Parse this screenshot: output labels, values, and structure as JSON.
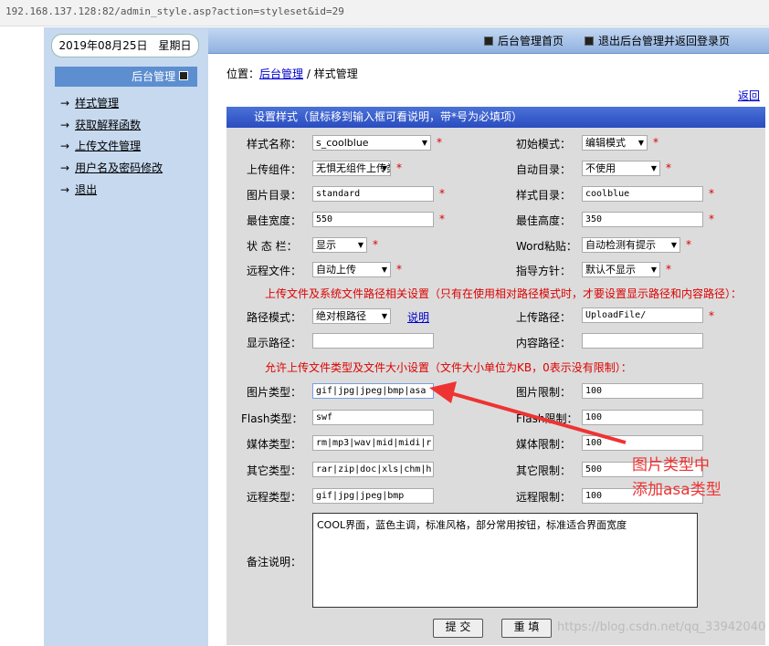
{
  "url": "192.168.137.128:82/admin_style.asp?action=styleset&id=29",
  "date": "2019年08月25日　星期日",
  "top_links": [
    "后台管理首页",
    "退出后台管理并返回登录页"
  ],
  "sidebar": {
    "header": "后台管理",
    "items": [
      "样式管理",
      "获取解释函数",
      "上传文件管理",
      "用户名及密码修改",
      "退出"
    ]
  },
  "breadcrumb": {
    "prefix": "位置：",
    "link": "后台管理",
    "sep": " / ",
    "current": "样式管理"
  },
  "back": "返回",
  "form": {
    "title": "设置样式（鼠标移到输入框可看说明，带*号为必填项）",
    "star": "*",
    "rows_left": [
      {
        "label": "样式名称：",
        "value": "s_coolblue",
        "type": "input"
      },
      {
        "label": "上传组件：",
        "value": "无惧无组件上传类",
        "type": "select"
      },
      {
        "label": "图片目录：",
        "value": "standard",
        "type": "input"
      },
      {
        "label": "最佳宽度：",
        "value": "550",
        "type": "input"
      },
      {
        "label": "状 态 栏：",
        "value": "显示",
        "type": "select"
      },
      {
        "label": "远程文件：",
        "value": "自动上传",
        "type": "select"
      }
    ],
    "rows_right": [
      {
        "label": "初始模式：",
        "value": "编辑模式",
        "type": "select"
      },
      {
        "label": "自动目录：",
        "value": "不使用",
        "type": "select"
      },
      {
        "label": "样式目录：",
        "value": "coolblue",
        "type": "input"
      },
      {
        "label": "最佳高度：",
        "value": "350",
        "type": "input"
      },
      {
        "label": "Word粘贴：",
        "value": "自动检测有提示",
        "type": "select"
      },
      {
        "label": "指导方针：",
        "value": "默认不显示",
        "type": "select"
      }
    ],
    "path_note": "上传文件及系统文件路径相关设置（只有在使用相对路径模式时，才要设置显示路径和内容路径）：",
    "path_mode": {
      "label": "路径模式：",
      "value": "绝对根路径",
      "help": "说明"
    },
    "upload_path": {
      "label": "上传路径：",
      "value": "UploadFile/"
    },
    "display_path": {
      "label": "显示路径：",
      "value": ""
    },
    "content_path": {
      "label": "内容路径：",
      "value": ""
    },
    "types_note": "允许上传文件类型及文件大小设置（文件大小单位为KB，0表示没有限制）：",
    "types": [
      {
        "label": "图片类型：",
        "value": "gif|jpg|jpeg|bmp|asa",
        "limit_label": "图片限制：",
        "limit": "100"
      },
      {
        "label": "Flash类型：",
        "value": "swf",
        "limit_label": "Flash限制：",
        "limit": "100"
      },
      {
        "label": "媒体类型：",
        "value": "rm|mp3|wav|mid|midi|r",
        "limit_label": "媒体限制：",
        "limit": "100"
      },
      {
        "label": "其它类型：",
        "value": "rar|zip|doc|xls|chm|h",
        "limit_label": "其它限制：",
        "limit": "500"
      },
      {
        "label": "远程类型：",
        "value": "gif|jpg|jpeg|bmp",
        "limit_label": "远程限制：",
        "limit": "100"
      }
    ],
    "notes_label": "备注说明：",
    "notes": "COOL界面，蓝色主调，标准风格，部分常用按钮，标准适合界面宽度",
    "submit": "提 交",
    "reset": "重 填"
  },
  "annotation": [
    "图片类型中",
    "添加asa类型"
  ],
  "watermark": "https://blog.csdn.net/qq_33942040"
}
